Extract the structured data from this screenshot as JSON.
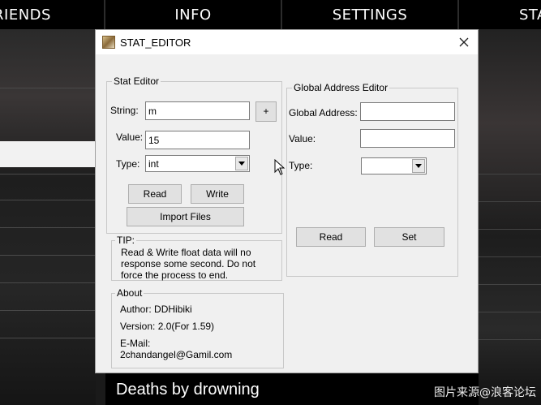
{
  "game": {
    "tabs": [
      {
        "label": "FRIENDS",
        "shown": "RIENDS"
      },
      {
        "label": "INFO"
      },
      {
        "label": "SETTINGS"
      },
      {
        "label": "STATS",
        "shown": "STA"
      }
    ],
    "bottom_row": "Deaths by drowning",
    "watermark": "图片来源@浪客论坛"
  },
  "dialog": {
    "title": "STAT_EDITOR",
    "stat_editor": {
      "legend": "Stat Editor",
      "string_label": "String:",
      "string_value": "m",
      "plus_label": "+",
      "value_label": "Value:",
      "value_value": "15",
      "type_label": "Type:",
      "type_value": "int",
      "read_label": "Read",
      "write_label": "Write",
      "import_label": "Import Files"
    },
    "global_editor": {
      "legend": "Global Address Editor",
      "address_label": "Global Address:",
      "address_value": "",
      "value_label": "Value:",
      "value_value": "",
      "type_label": "Type:",
      "type_value": "",
      "read_label": "Read",
      "set_label": "Set"
    },
    "tip": {
      "legend": "TIP:",
      "line1": "Read & Write float data will no",
      "line2": "response some second. Do not",
      "line3": "force the process to end."
    },
    "about": {
      "legend": "About",
      "author": "Author:  DDHibiki",
      "version": "Version:  2.0(For 1.59)",
      "email_label": "E-Mail:",
      "email": "2chandangel@Gamil.com"
    }
  },
  "colors": {
    "dialog_bg": "#f0f0f0",
    "titlebar_bg": "#ffffff",
    "button_bg": "#e1e1e1",
    "game_bg": "#000000"
  },
  "icons": {
    "app": "app-icon",
    "close": "close-icon",
    "dropdown": "chevron-down-icon",
    "cursor": "mouse-cursor-icon"
  }
}
